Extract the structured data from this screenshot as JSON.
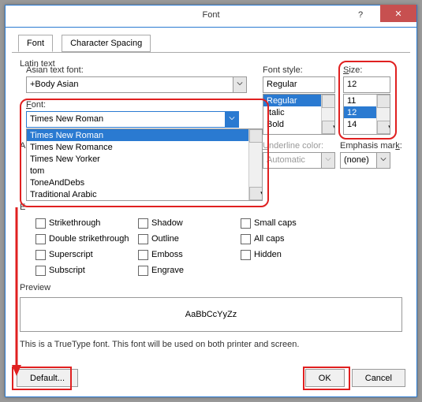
{
  "title": "Font",
  "help_glyph": "?",
  "close_glyph": "✕",
  "tabs": {
    "font": "Font",
    "spacing": "Character Spacing"
  },
  "latin_text": "Latin text",
  "asian_font_label": "Asian text font:",
  "asian_font_value": "+Body Asian",
  "font_label": "Font:",
  "font_value": "Times New Roman",
  "font_list": [
    "Times New Roman",
    "Times New Romance",
    "Times New Yorker",
    "tom",
    "ToneAndDebs",
    "Traditional Arabic"
  ],
  "font_style_label": "Font style:",
  "font_style_value": "Regular",
  "font_style_list": [
    "Regular",
    "Italic",
    "Bold"
  ],
  "size_label": "Size:",
  "size_value": "12",
  "size_list": [
    "11",
    "12",
    "14"
  ],
  "all_text_label": "All text",
  "underline_color_label": "Underline color:",
  "underline_color_value": "Automatic",
  "emphasis_label": "Emphasis mark:",
  "emphasis_value": "(none)",
  "effects_label": "Effects",
  "chk": {
    "strike": "Strikethrough",
    "dstrike": "Double strikethrough",
    "super": "Superscript",
    "sub": "Subscript",
    "shadow": "Shadow",
    "outline": "Outline",
    "emboss": "Emboss",
    "engrave": "Engrave",
    "smallcaps": "Small caps",
    "allcaps": "All caps",
    "hidden": "Hidden"
  },
  "preview_label": "Preview",
  "preview_text": "AaBbCcYyZz",
  "hint": "This is a TrueType font. This font will be used on both printer and screen.",
  "buttons": {
    "default": "Default...",
    "ok": "OK",
    "cancel": "Cancel"
  },
  "colors": {
    "highlight_red": "#e02020",
    "select_blue": "#2a7ad1",
    "close_red": "#c75050"
  }
}
